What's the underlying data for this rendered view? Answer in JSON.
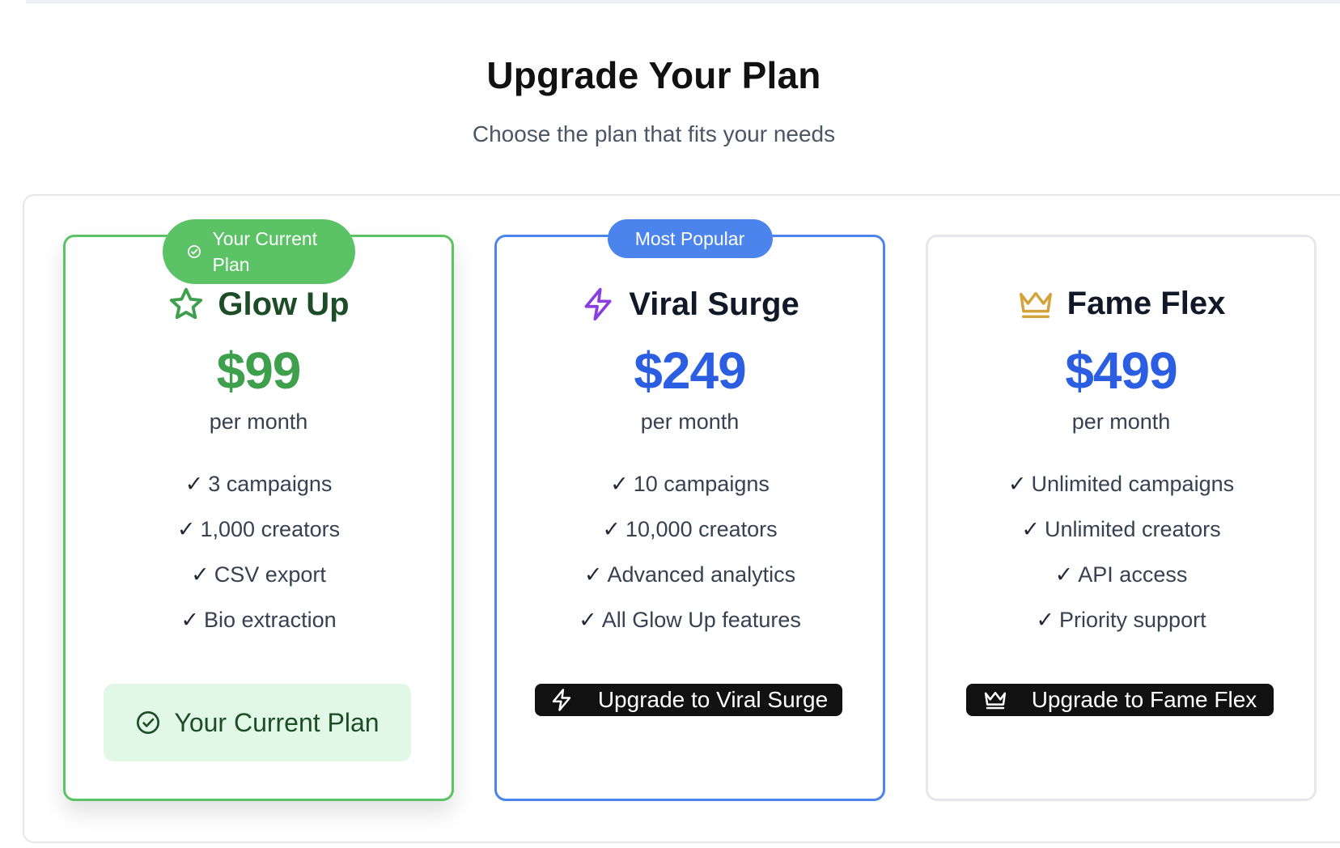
{
  "header": {
    "title": "Upgrade Your Plan",
    "subtitle": "Choose the plan that fits your needs"
  },
  "plans": [
    {
      "name": "Glow Up",
      "icon": "star-icon",
      "price": "$99",
      "period": "per month",
      "badge": "Your Current Plan",
      "features": [
        "3 campaigns",
        "1,000 creators",
        "CSV export",
        "Bio extraction"
      ],
      "action_label": "Your Current Plan",
      "accent": "#5cc266"
    },
    {
      "name": "Viral Surge",
      "icon": "lightning-icon",
      "price": "$249",
      "period": "per month",
      "badge": "Most Popular",
      "features": [
        "10 campaigns",
        "10,000 creators",
        "Advanced analytics",
        "All Glow Up features"
      ],
      "action_label": "Upgrade to Viral Surge",
      "accent": "#4b84ec"
    },
    {
      "name": "Fame Flex",
      "icon": "crown-icon",
      "price": "$499",
      "period": "per month",
      "badge": "",
      "features": [
        "Unlimited campaigns",
        "Unlimited creators",
        "API access",
        "Priority support"
      ],
      "action_label": "Upgrade to Fame Flex",
      "accent": "#d4a23a"
    }
  ],
  "check_mark": "✓"
}
